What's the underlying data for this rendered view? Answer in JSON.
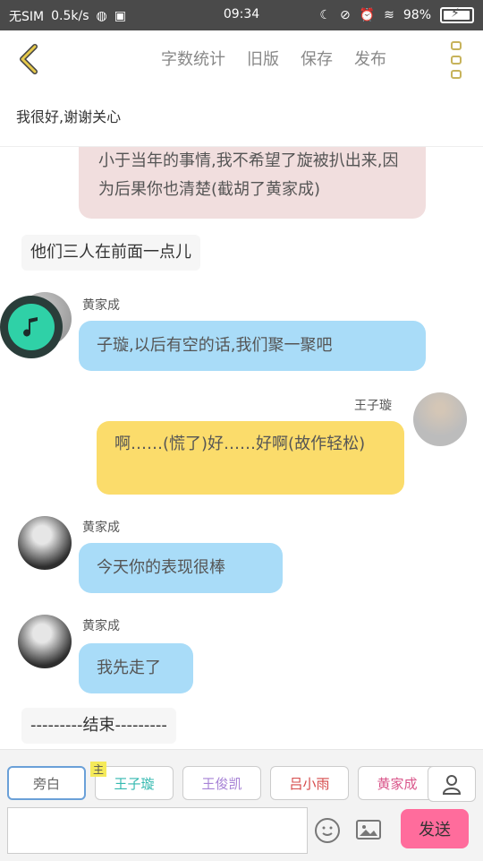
{
  "status": {
    "sim": "无SIM",
    "speed": "0.5k/s",
    "time": "09:34",
    "battery": "98%"
  },
  "toolbar": {
    "tabs": [
      "字数统计",
      "旧版",
      "保存",
      "发布"
    ]
  },
  "subtitle": "我很好,谢谢关心",
  "messages": [
    {
      "type": "pink",
      "text": "小于当年的事情,我不希望了旋被扒出来,因为后果你也清楚(截胡了黄家成)"
    },
    {
      "type": "narration",
      "text": "他们三人在前面一点儿"
    },
    {
      "type": "left",
      "name": "黄家成",
      "text": "子璇,以后有空的话,我们聚一聚吧"
    },
    {
      "type": "right",
      "name": "王子璇",
      "text": "啊……(慌了)好……好啊(故作轻松)"
    },
    {
      "type": "left",
      "name": "黄家成",
      "text": "今天你的表现很棒"
    },
    {
      "type": "left",
      "name": "黄家成",
      "text": "我先走了"
    },
    {
      "type": "narration",
      "text": "---------结束---------"
    }
  ],
  "characters": {
    "narrator": "旁白",
    "main_badge": "主",
    "list": [
      {
        "name": "王子璇",
        "color": "#35b9b0"
      },
      {
        "name": "王俊凯",
        "color": "#a783d6"
      },
      {
        "name": "吕小雨",
        "color": "#d64a4a"
      },
      {
        "name": "黄家成",
        "color": "#d9558a"
      }
    ]
  },
  "input": {
    "value": "",
    "placeholder": ""
  },
  "send_label": "发送",
  "colors": {
    "accent_pink": "#ff6c9c",
    "bubble_blue": "#a9dcf8",
    "bubble_yellow": "#fbdc6b",
    "bubble_pink": "#f1dede"
  }
}
